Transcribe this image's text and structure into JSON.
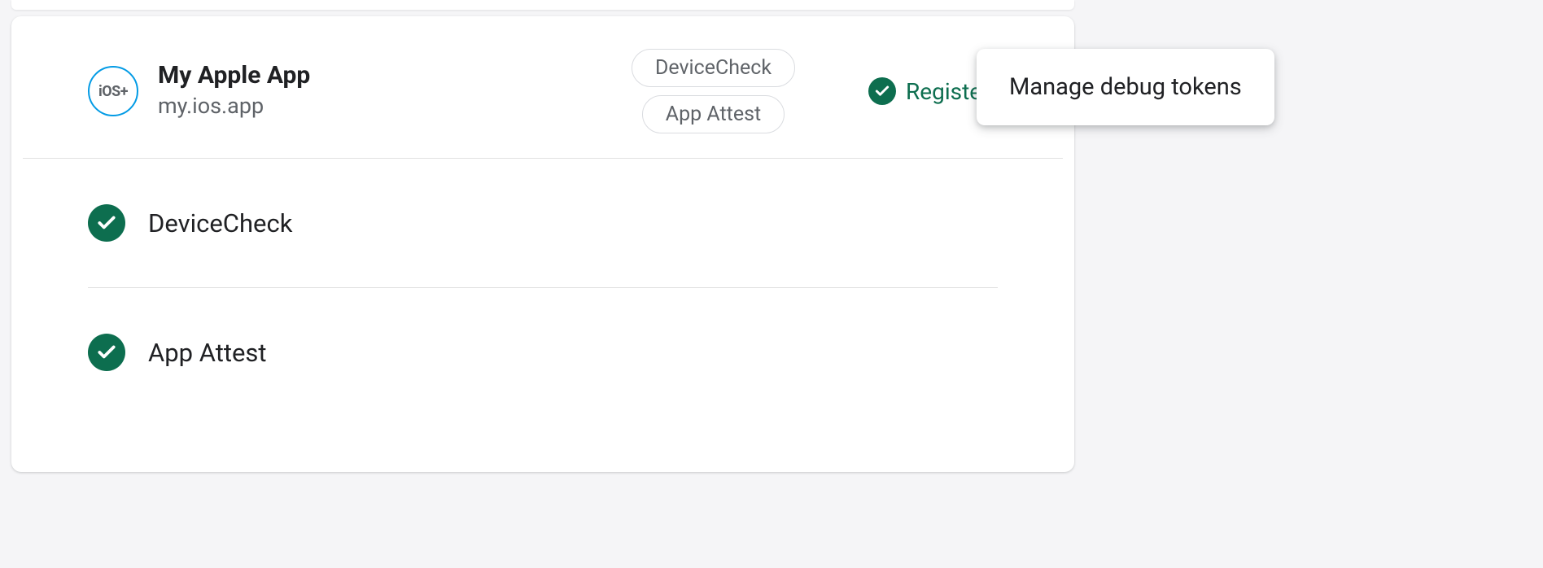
{
  "app": {
    "icon_label": "iOS+",
    "name": "My Apple App",
    "bundle_id": "my.ios.app"
  },
  "chips": [
    "DeviceCheck",
    "App Attest"
  ],
  "status": {
    "label": "Registered"
  },
  "providers": [
    {
      "name": "DeviceCheck"
    },
    {
      "name": "App Attest"
    }
  ],
  "popover": {
    "label": "Manage debug tokens"
  }
}
